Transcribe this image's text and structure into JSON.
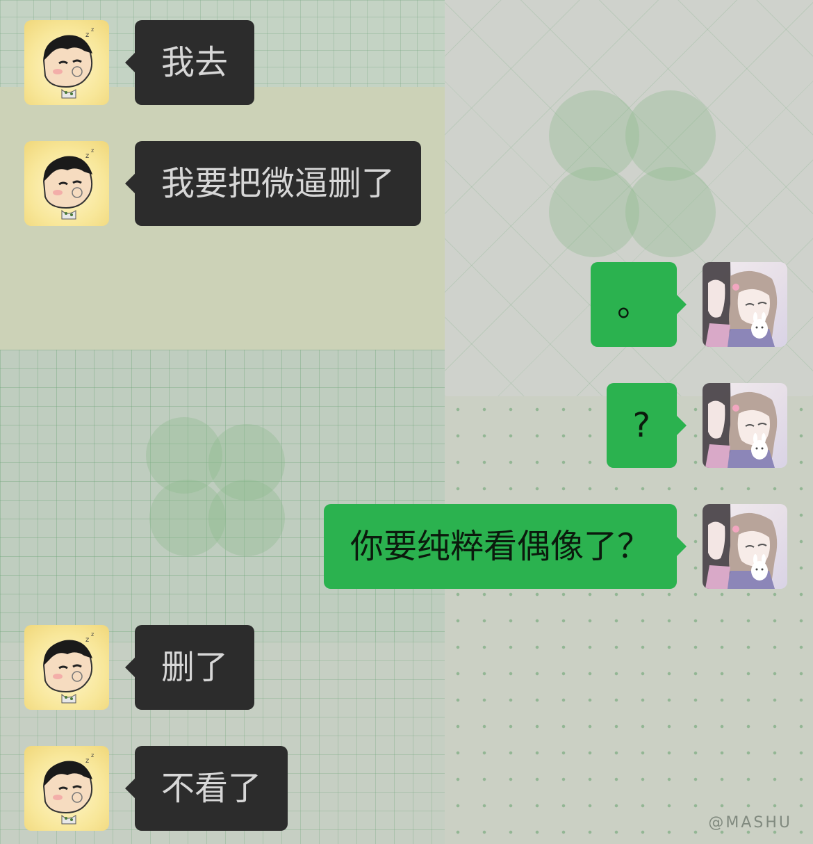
{
  "watermark": "@MASHU",
  "messages": [
    {
      "side": "left",
      "avatar": "shinchan-avatar",
      "text": "我去"
    },
    {
      "side": "left",
      "avatar": "shinchan-avatar",
      "text": "我要把微逼删了"
    },
    {
      "side": "right",
      "avatar": "anime-girls-avatar",
      "text": "。"
    },
    {
      "side": "right",
      "avatar": "anime-girls-avatar",
      "text": "?"
    },
    {
      "side": "right",
      "avatar": "anime-girls-avatar",
      "text": "你要纯粹看偶像了？"
    },
    {
      "side": "left",
      "avatar": "shinchan-avatar",
      "text": "删了"
    },
    {
      "side": "left",
      "avatar": "shinchan-avatar",
      "text": "不看了"
    }
  ],
  "colors": {
    "incoming_bubble": "#2c2c2c",
    "incoming_text": "#d7d7d7",
    "outgoing_bubble": "#2bb24f",
    "outgoing_text": "#0b1a0d"
  }
}
